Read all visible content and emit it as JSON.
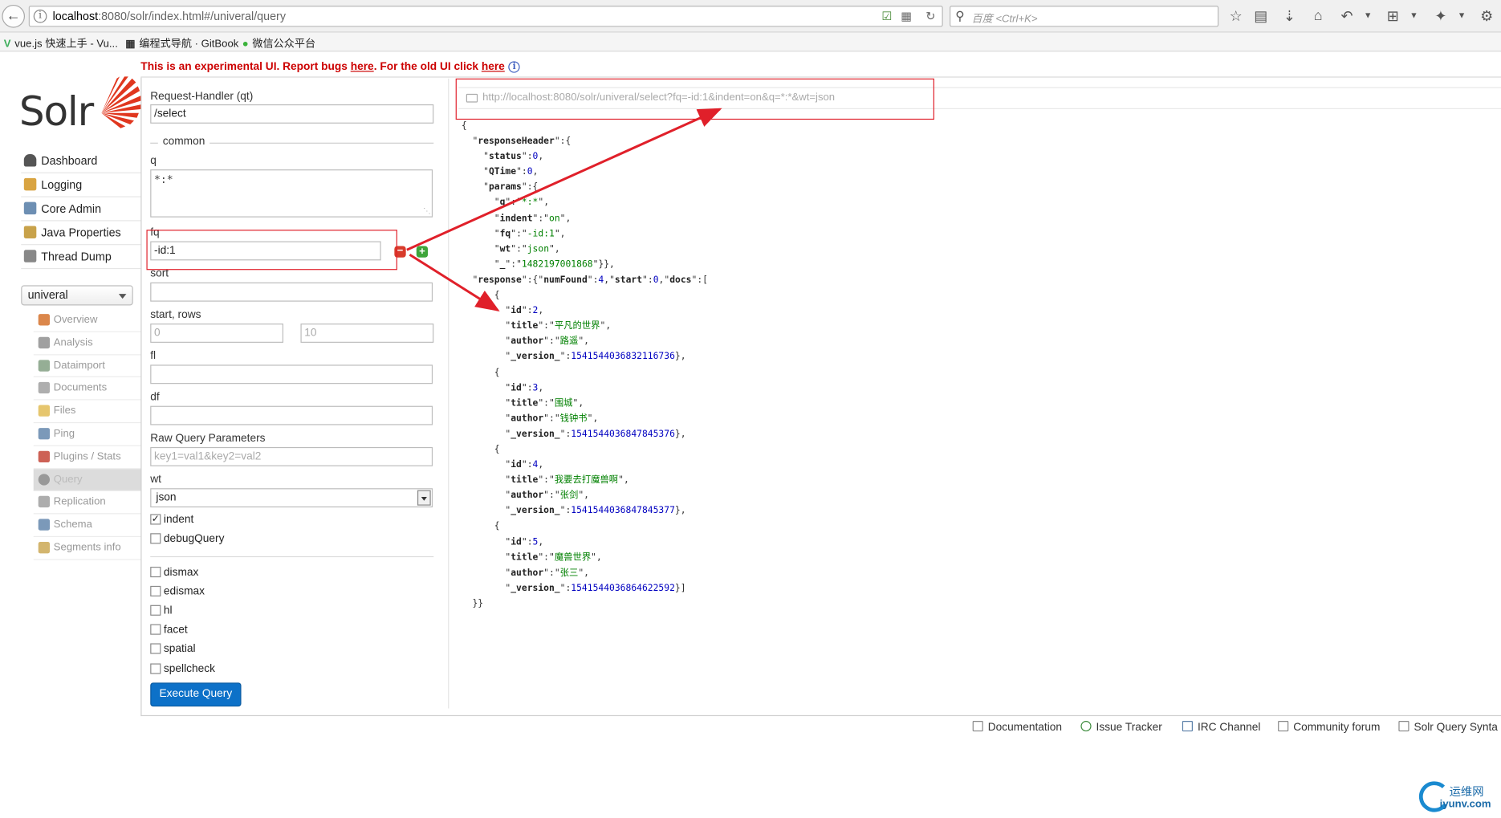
{
  "browser": {
    "url_host": "localhost",
    "url_rest": ":8080/solr/index.html#/univeral/query",
    "search_placeholder": "百度 <Ctrl+K>",
    "bookmarks": [
      "vue.js 快速上手 - Vu...",
      "编程式导航 · GitBook",
      "微信公众平台"
    ]
  },
  "notice": {
    "prefix": "This is an experimental UI. Report bugs ",
    "link1": "here",
    "middle": ". For the old UI click ",
    "link2": "here"
  },
  "logo": {
    "text": "Solr"
  },
  "main_nav": [
    {
      "label": "Dashboard",
      "icon": "dashboard-icon",
      "color": "#555555"
    },
    {
      "label": "Logging",
      "icon": "logging-icon",
      "color": "#d9a441"
    },
    {
      "label": "Core Admin",
      "icon": "core-admin-icon",
      "color": "#6d8fb3"
    },
    {
      "label": "Java Properties",
      "icon": "java-properties-icon",
      "color": "#c8a24a"
    },
    {
      "label": "Thread Dump",
      "icon": "thread-dump-icon",
      "color": "#888888"
    }
  ],
  "core_selector": {
    "value": "univeral"
  },
  "core_nav": [
    {
      "label": "Overview",
      "icon": "overview-icon",
      "color": "#d2691e"
    },
    {
      "label": "Analysis",
      "icon": "analysis-icon",
      "color": "#888888"
    },
    {
      "label": "Dataimport",
      "icon": "dataimport-icon",
      "color": "#7a9a7a"
    },
    {
      "label": "Documents",
      "icon": "documents-icon",
      "color": "#9a9a9a"
    },
    {
      "label": "Files",
      "icon": "files-icon",
      "color": "#e0b84a"
    },
    {
      "label": "Ping",
      "icon": "ping-icon",
      "color": "#5a7fa8"
    },
    {
      "label": "Plugins / Stats",
      "icon": "plugins-icon",
      "color": "#c0392b"
    },
    {
      "label": "Query",
      "icon": "query-icon",
      "color": "#888888"
    },
    {
      "label": "Replication",
      "icon": "replication-icon",
      "color": "#999999"
    },
    {
      "label": "Schema",
      "icon": "schema-icon",
      "color": "#5a7fa8"
    },
    {
      "label": "Segments info",
      "icon": "segments-icon",
      "color": "#c8a24a"
    }
  ],
  "form": {
    "qt_label": "Request-Handler (qt)",
    "qt_value": "/select",
    "legend_common": "common",
    "q_label": "q",
    "q_value": "*:*",
    "fq_label": "fq",
    "fq_value": "-id:1",
    "sort_label": "sort",
    "sort_value": "",
    "start_rows_label": "start, rows",
    "start_placeholder": "0",
    "rows_placeholder": "10",
    "fl_label": "fl",
    "fl_value": "",
    "df_label": "df",
    "df_value": "",
    "raw_label": "Raw Query Parameters",
    "raw_placeholder": "key1=val1&key2=val2",
    "wt_label": "wt",
    "wt_value": "json",
    "checkboxes": [
      {
        "label": "indent",
        "checked": true
      },
      {
        "label": "debugQuery",
        "checked": false
      },
      {
        "label": "dismax",
        "checked": false
      },
      {
        "label": "edismax",
        "checked": false
      },
      {
        "label": "hl",
        "checked": false
      },
      {
        "label": "facet",
        "checked": false
      },
      {
        "label": "spatial",
        "checked": false
      },
      {
        "label": "spellcheck",
        "checked": false
      }
    ],
    "execute_label": "Execute Query"
  },
  "response": {
    "url": "http://localhost:8080/solr/univeral/select?fq=-id:1&indent=on&q=*:*&wt=json",
    "responseHeader": {
      "status": "0",
      "QTime": "0",
      "q": "*:*",
      "indent": "on",
      "fq": "-id:1",
      "wt": "json",
      "_": "1482197001868"
    },
    "numFound": "4",
    "start": "0",
    "docs": [
      {
        "id": "2",
        "title": "平凡的世界",
        "author": "路遥",
        "version": "1541544036832116736"
      },
      {
        "id": "3",
        "title": "围城",
        "author": "钱钟书",
        "version": "1541544036847845376"
      },
      {
        "id": "4",
        "title": "我要去打魔兽啊",
        "author": "张剑",
        "version": "1541544036847845377"
      },
      {
        "id": "5",
        "title": "魔兽世界",
        "author": "张三",
        "version": "1541544036864622592"
      }
    ]
  },
  "footer": [
    {
      "label": "Documentation",
      "icon": "documentation-icon"
    },
    {
      "label": "Issue Tracker",
      "icon": "bug-icon"
    },
    {
      "label": "IRC Channel",
      "icon": "irc-icon"
    },
    {
      "label": "Community forum",
      "icon": "mail-icon"
    },
    {
      "label": "Solr Query Synta",
      "icon": "syntax-icon"
    }
  ],
  "watermark": {
    "line1": "运维网",
    "line2": "iyunv.com"
  },
  "colors": {
    "accent": "#0d71c8",
    "annotation": "#e0202a",
    "notice": "#cc0000"
  }
}
